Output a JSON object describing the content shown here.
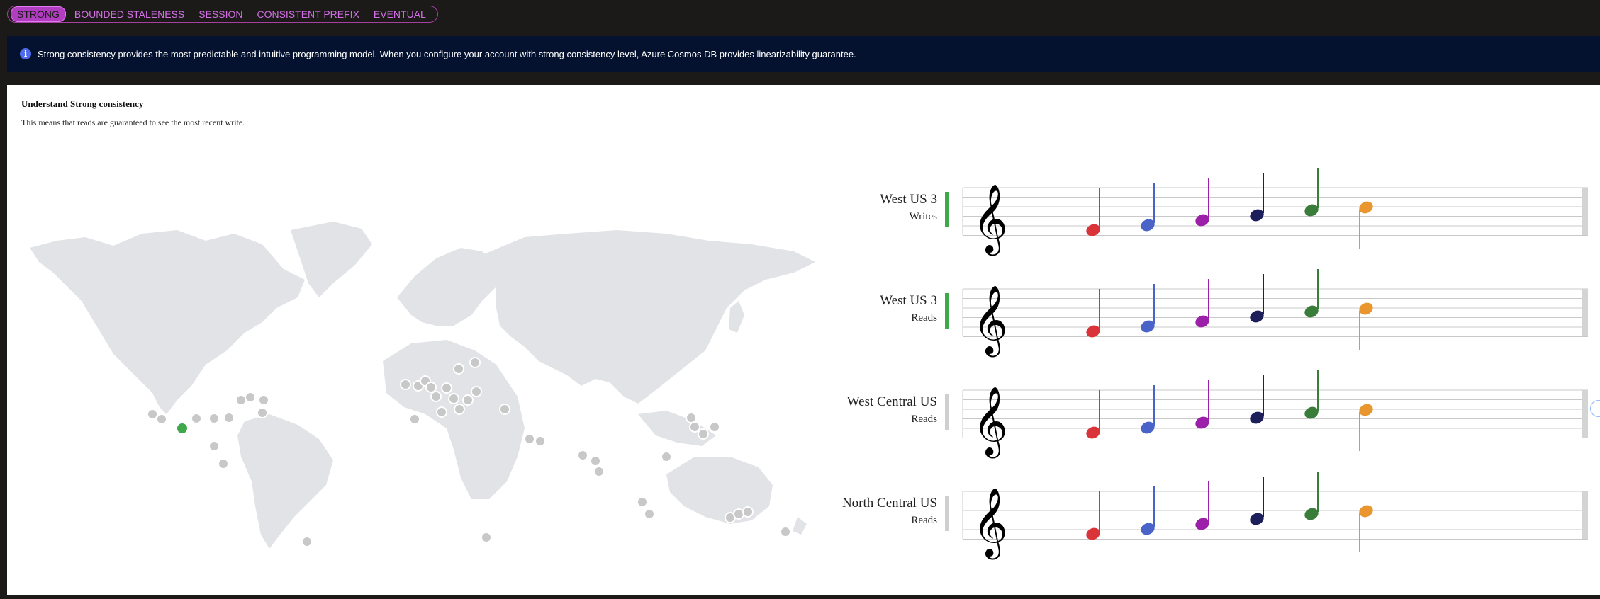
{
  "tabs": [
    {
      "label": "STRONG",
      "active": true
    },
    {
      "label": "BOUNDED STALENESS",
      "active": false
    },
    {
      "label": "SESSION",
      "active": false
    },
    {
      "label": "CONSISTENT PREFIX",
      "active": false
    },
    {
      "label": "EVENTUAL",
      "active": false
    }
  ],
  "banner": {
    "icon": "info-icon",
    "text": "Strong consistency provides the most predictable and intuitive programming model. When you configure your account with strong consistency level, Azure Cosmos DB provides linearizability guarantee."
  },
  "panel": {
    "title": "Understand Strong consistency",
    "subtitle": "This means that reads are guaranteed to see the most recent write."
  },
  "map": {
    "active_region_color": "#3ea84a",
    "inactive_region_color": "#c8c8c8",
    "land_color": "#e1e3e6"
  },
  "regions": [
    {
      "name": "West US 3",
      "role": "Writes",
      "status_color": "#3ea84a"
    },
    {
      "name": "West US 3",
      "role": "Reads",
      "status_color": "#3ea84a"
    },
    {
      "name": "West Central US",
      "role": "Reads",
      "status_color": "#cfcfcf"
    },
    {
      "name": "North Central US",
      "role": "Reads",
      "status_color": "#cfcfcf"
    }
  ],
  "notes": {
    "colors": [
      "#d9343a",
      "#4a63c8",
      "#9b1fa8",
      "#1d1f5a",
      "#3a7d3a",
      "#e8962d"
    ],
    "count_per_staff": 6
  }
}
